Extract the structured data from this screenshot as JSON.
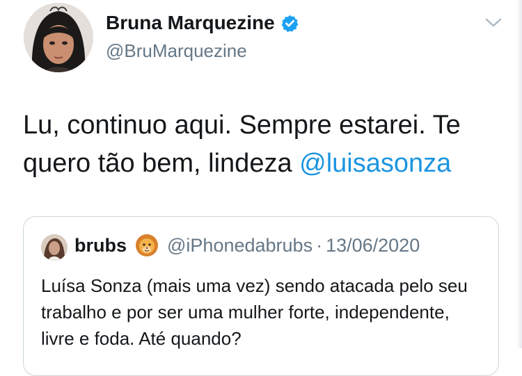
{
  "author": {
    "name": "Bruna Marquezine",
    "handle": "@BruMarquezine",
    "avatar_icon": "profile-photo",
    "verified_icon": "verified-badge-icon"
  },
  "tweet": {
    "text": "Lu, continuo aqui. Sempre estarei. Te quero tão bem, lindeza ",
    "mention": "@luisasonza"
  },
  "quoted_tweet": {
    "name": "brubs",
    "emoji_icon": "lion-emoji-icon",
    "handle": "@iPhonedabrubs",
    "separator": "·",
    "date": "13/06/2020",
    "text": "Luísa Sonza (mais uma vez) sendo atacada pelo seu trabalho e por ser uma mulher forte, independente, livre e foda. Até quando?"
  },
  "colors": {
    "accent": "#1b95e0",
    "text_primary": "#14171a",
    "text_secondary": "#657786",
    "border": "#ccd6dd"
  }
}
